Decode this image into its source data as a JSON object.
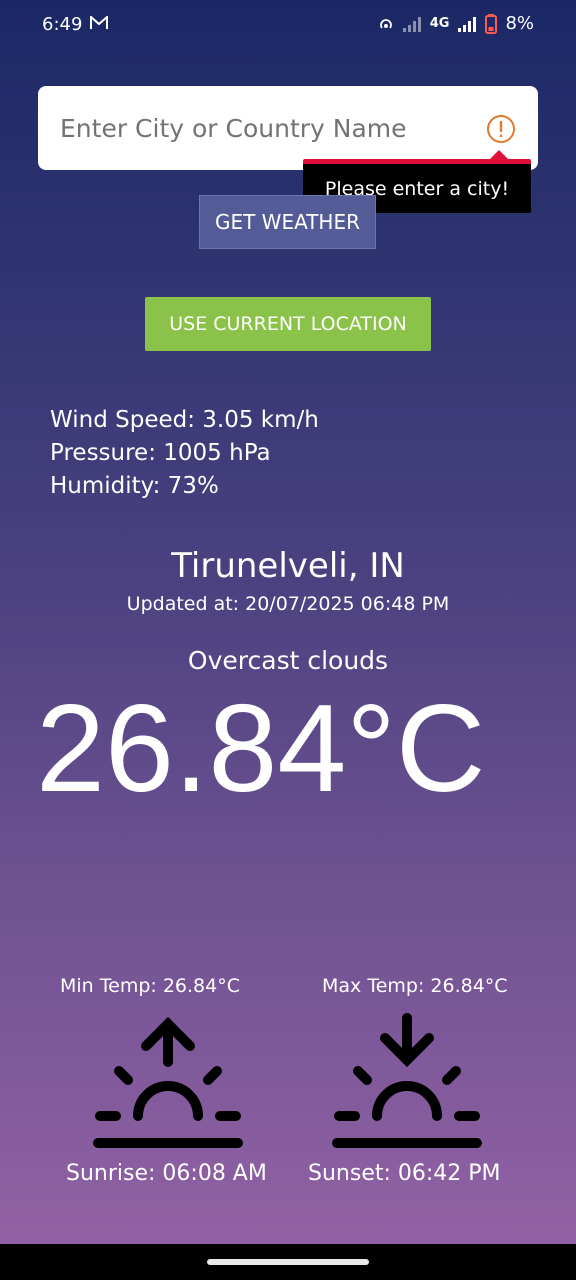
{
  "status_bar": {
    "time": "6:49",
    "network": "4G",
    "battery": "8%"
  },
  "search": {
    "placeholder": "Enter City or Country Name",
    "value": "",
    "error_tooltip": "Please enter a city!"
  },
  "buttons": {
    "get_weather": "GET WEATHER",
    "use_location": "USE CURRENT LOCATION"
  },
  "details": {
    "wind_speed": "Wind Speed: 3.05 km/h",
    "pressure": "Pressure: 1005 hPa",
    "humidity": "Humidity: 73%"
  },
  "weather": {
    "city": "Tirunelveli, IN",
    "updated": "Updated at: 20/07/2025 06:48 PM",
    "description": "Overcast clouds",
    "temperature": "26.84°C",
    "min_temp": "Min Temp: 26.84°C",
    "max_temp": "Max Temp: 26.84°C",
    "sunrise": "Sunrise: 06:08 AM",
    "sunset": "Sunset: 06:42 PM"
  },
  "colors": {
    "location_button": "#8bc34a",
    "get_weather_button": "#535c96",
    "error_accent": "#e0103a",
    "warning_icon": "#e07a2e"
  },
  "icons": [
    "mail-icon",
    "hotspot-icon",
    "signal-icon",
    "battery-icon",
    "warning-icon",
    "sunrise-icon",
    "sunset-icon"
  ]
}
